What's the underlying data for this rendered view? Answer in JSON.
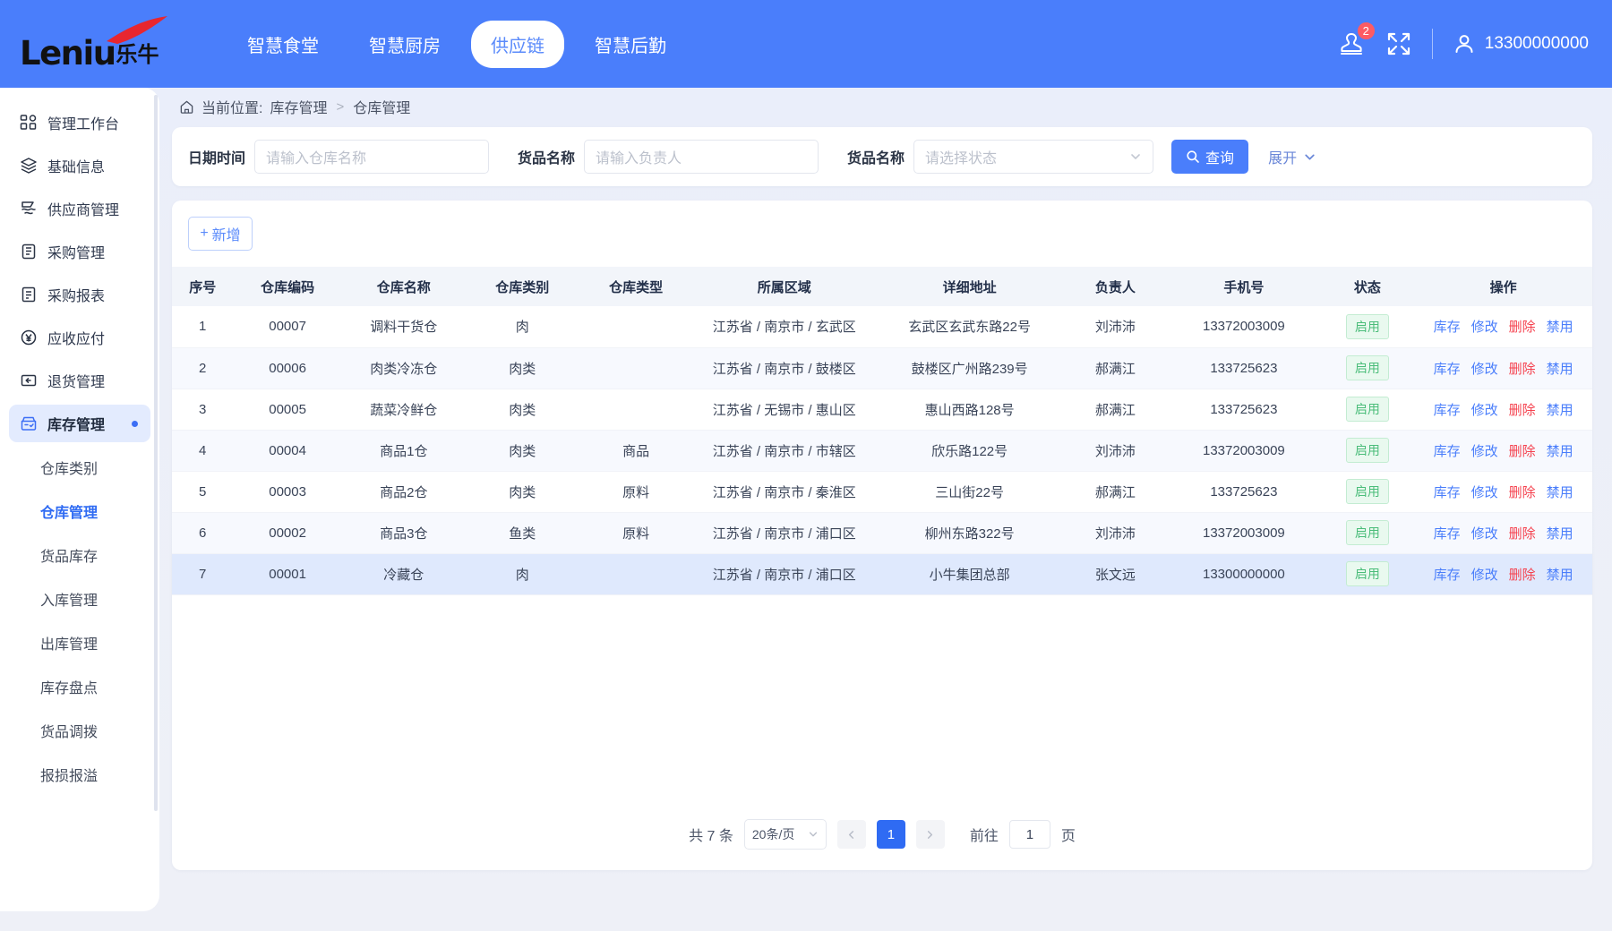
{
  "brand": {
    "logo_text": "Leniu",
    "logo_cn": "乐牛"
  },
  "header": {
    "nav": [
      {
        "label": "智慧食堂",
        "active": false
      },
      {
        "label": "智慧厨房",
        "active": false
      },
      {
        "label": "供应链",
        "active": true
      },
      {
        "label": "智慧后勤",
        "active": false
      }
    ],
    "notification_badge": "2",
    "username": "13300000000",
    "accent_color": "#4a7efb",
    "badge_color": "#fd5b63"
  },
  "sidebar": {
    "items": [
      {
        "label": "管理工作台",
        "icon": "dashboard-icon"
      },
      {
        "label": "基础信息",
        "icon": "layers-icon"
      },
      {
        "label": "供应商管理",
        "icon": "supplier-icon"
      },
      {
        "label": "采购管理",
        "icon": "clipboard-icon"
      },
      {
        "label": "采购报表",
        "icon": "report-icon"
      },
      {
        "label": "应收应付",
        "icon": "yuan-icon"
      },
      {
        "label": "退货管理",
        "icon": "return-icon"
      },
      {
        "label": "库存管理",
        "icon": "inventory-icon",
        "active": true
      }
    ],
    "sub_items": [
      {
        "label": "仓库类别",
        "active": false
      },
      {
        "label": "仓库管理",
        "active": true
      },
      {
        "label": "货品库存",
        "active": false
      },
      {
        "label": "入库管理",
        "active": false
      },
      {
        "label": "出库管理",
        "active": false
      },
      {
        "label": "库存盘点",
        "active": false
      },
      {
        "label": "货品调拨",
        "active": false
      },
      {
        "label": "报损报溢",
        "active": false
      }
    ]
  },
  "breadcrumb": {
    "prefix": "当前位置:",
    "items": [
      "库存管理",
      "仓库管理"
    ],
    "separator": ">"
  },
  "search": {
    "fields": [
      {
        "label": "日期时间",
        "placeholder": "请输入仓库名称",
        "value": "",
        "type": "text"
      },
      {
        "label": "货品名称",
        "placeholder": "请输入负责人",
        "value": "",
        "type": "text"
      },
      {
        "label": "货品名称",
        "placeholder": "请选择状态",
        "value": "",
        "type": "select"
      }
    ],
    "query_button": "查询",
    "expand_label": "展开"
  },
  "toolbar": {
    "add_label": "新增",
    "add_icon": "plus-icon"
  },
  "table": {
    "columns": [
      "序号",
      "仓库编码",
      "仓库名称",
      "仓库类别",
      "仓库类型",
      "所属区域",
      "详细地址",
      "负责人",
      "手机号",
      "状态",
      "操作"
    ],
    "ops": [
      {
        "label": "库存",
        "color": "blue"
      },
      {
        "label": "修改",
        "color": "blue"
      },
      {
        "label": "删除",
        "color": "red"
      },
      {
        "label": "禁用",
        "color": "blue"
      }
    ],
    "rows": [
      {
        "index": "1",
        "code": "00007",
        "name": "调料干货仓",
        "category": "肉",
        "type": "",
        "region": "江苏省 / 南京市 / 玄武区",
        "address": "玄武区玄武东路22号",
        "owner": "刘沛沛",
        "phone": "13372003009",
        "status": "启用",
        "selected": false
      },
      {
        "index": "2",
        "code": "00006",
        "name": "肉类冷冻仓",
        "category": "肉类",
        "type": "",
        "region": "江苏省 / 南京市 / 鼓楼区",
        "address": "鼓楼区广州路239号",
        "owner": "郝满江",
        "phone": "133725623",
        "status": "启用",
        "selected": false
      },
      {
        "index": "3",
        "code": "00005",
        "name": "蔬菜冷鲜仓",
        "category": "肉类",
        "type": "",
        "region": "江苏省 / 无锡市 / 惠山区",
        "address": "惠山西路128号",
        "owner": "郝满江",
        "phone": "133725623",
        "status": "启用",
        "selected": false
      },
      {
        "index": "4",
        "code": "00004",
        "name": "商品1仓",
        "category": "肉类",
        "type": "商品",
        "region": "江苏省 / 南京市 / 市辖区",
        "address": "欣乐路122号",
        "owner": "刘沛沛",
        "phone": "13372003009",
        "status": "启用",
        "selected": false
      },
      {
        "index": "5",
        "code": "00003",
        "name": "商品2仓",
        "category": "肉类",
        "type": "原料",
        "region": "江苏省 / 南京市 / 秦淮区",
        "address": "三山街22号",
        "owner": "郝满江",
        "phone": "133725623",
        "status": "启用",
        "selected": false
      },
      {
        "index": "6",
        "code": "00002",
        "name": "商品3仓",
        "category": "鱼类",
        "type": "原料",
        "region": "江苏省 / 南京市 / 浦口区",
        "address": "柳州东路322号",
        "owner": "刘沛沛",
        "phone": "13372003009",
        "status": "启用",
        "selected": false
      },
      {
        "index": "7",
        "code": "00001",
        "name": "冷藏仓",
        "category": "肉",
        "type": "",
        "region": "江苏省 / 南京市 / 浦口区",
        "address": "小牛集团总部",
        "owner": "张文远",
        "phone": "13300000000",
        "status": "启用",
        "selected": true
      }
    ]
  },
  "pagination": {
    "total_text": "共 7 条",
    "page_size": "20条/页",
    "current_page": "1",
    "jump_label": "前往",
    "jump_value": "1",
    "jump_unit": "页"
  }
}
